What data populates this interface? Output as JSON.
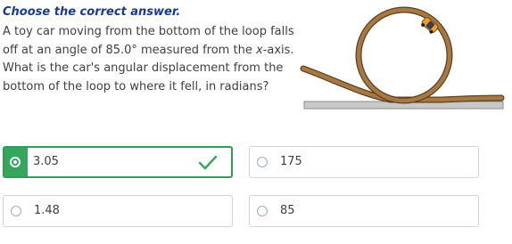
{
  "instruction": "Choose the correct answer.",
  "question": {
    "part1": "A toy car moving from the bottom of the loop falls off at an angle of 85.0° measured from the ",
    "variable": "x",
    "part2": "-axis. What is the car's angular displacement from the bottom of the loop to where it fell, in radians?"
  },
  "figure": {
    "track_color": "#a67843",
    "track_edge_color": "#5e3f1f",
    "ground_color": "#c9c9c9",
    "car_color": "#f29f25"
  },
  "options": [
    {
      "label": "3.05",
      "selected": true,
      "correct": true
    },
    {
      "label": "175",
      "selected": false
    },
    {
      "label": "1.48",
      "selected": false
    },
    {
      "label": "85",
      "selected": false
    }
  ],
  "colors": {
    "accent_green": "#35a65c",
    "instruction_blue": "#1b3a8f",
    "border_gray": "#cfd4d9"
  }
}
